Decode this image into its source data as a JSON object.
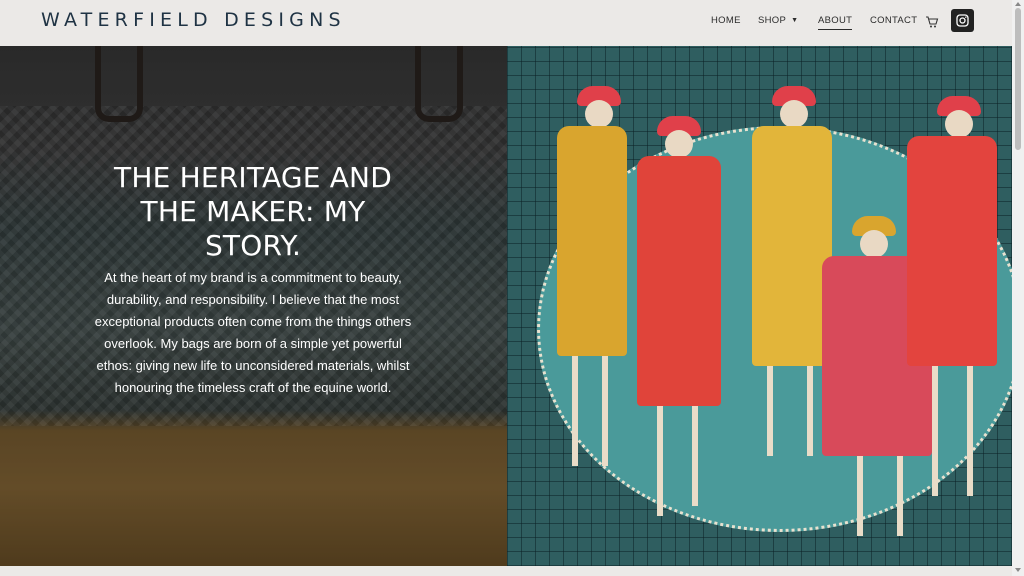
{
  "brand": {
    "logo": "WATERFIELD DESIGNS"
  },
  "nav": {
    "items": [
      {
        "label": "HOME"
      },
      {
        "label": "SHOP"
      },
      {
        "label": "ABOUT"
      },
      {
        "label": "CONTACT"
      }
    ],
    "active": "ABOUT",
    "icons": [
      "cart-icon",
      "instagram-icon"
    ]
  },
  "hero": {
    "title": "THE HERITAGE AND THE MAKER: MY STORY.",
    "body": "At the heart of my brand is a commitment to beauty, durability, and responsibility. I believe that the most exceptional products often come from the things others overlook. My bags are born of a simple yet powerful ethos: giving new life to unconsidered materials, whilst honouring the timeless craft of the equine world."
  },
  "colors": {
    "header_bg": "#ebe9e7",
    "logo_text": "#1f3344",
    "instagram_button": "#222222"
  }
}
